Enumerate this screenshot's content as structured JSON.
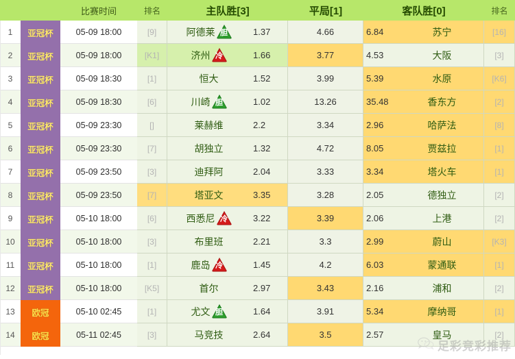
{
  "header": {
    "no": "",
    "league": "",
    "time": "比赛时间",
    "rank_home": "排名",
    "home_win": "主队胜[3]",
    "draw": "平局[1]",
    "away_win": "客队胜[0]",
    "rank_away": "排名"
  },
  "watermark": {
    "text": "足彩竞彩推荐",
    "icon": "wechat-icon"
  },
  "colors": {
    "header_bg": "#b7e76a",
    "league_acl": "#9470ab",
    "league_ucl": "#f4650c",
    "highlight_orange": "#ffd972",
    "highlight_green": "#d6f0ac",
    "cell_bg": "#eef4e4",
    "badge_dan": "#2e9e2e",
    "badge_leng": "#d41b1b"
  },
  "rows": [
    {
      "no": "1",
      "league": "亚冠杯",
      "league_type": "acl",
      "time": "05-09 18:00",
      "home_rank": "[9]",
      "home_team": "阿德莱",
      "home_badge": "胆",
      "home_odd": "1.37",
      "draw_odd": "4.66",
      "away_odd": "6.84",
      "away_team": "苏宁",
      "away_badge": "",
      "away_rank": "[16]",
      "alt": false,
      "home_hl": "",
      "draw_hl": "",
      "away_hl": "orange"
    },
    {
      "no": "2",
      "league": "亚冠杯",
      "league_type": "acl",
      "time": "05-09 18:00",
      "home_rank": "[K1]",
      "home_team": "济州",
      "home_badge": "冷",
      "home_odd": "1.66",
      "draw_odd": "3.77",
      "away_odd": "4.53",
      "away_team": "大阪",
      "away_badge": "",
      "away_rank": "[3]",
      "alt": true,
      "home_hl": "green",
      "draw_hl": "orange",
      "away_hl": ""
    },
    {
      "no": "3",
      "league": "亚冠杯",
      "league_type": "acl",
      "time": "05-09 18:30",
      "home_rank": "[1]",
      "home_team": "恒大",
      "home_badge": "",
      "home_odd": "1.52",
      "draw_odd": "3.99",
      "away_odd": "5.39",
      "away_team": "水原",
      "away_badge": "",
      "away_rank": "[K6]",
      "alt": false,
      "home_hl": "",
      "draw_hl": "",
      "away_hl": "orange"
    },
    {
      "no": "4",
      "league": "亚冠杯",
      "league_type": "acl",
      "time": "05-09 18:30",
      "home_rank": "[6]",
      "home_team": "川崎",
      "home_badge": "胆",
      "home_odd": "1.02",
      "draw_odd": "13.26",
      "away_odd": "35.48",
      "away_team": "香东方",
      "away_badge": "",
      "away_rank": "[2]",
      "alt": true,
      "home_hl": "",
      "draw_hl": "",
      "away_hl": "orange"
    },
    {
      "no": "5",
      "league": "亚冠杯",
      "league_type": "acl",
      "time": "05-09 23:30",
      "home_rank": "[]",
      "home_team": "莱赫维",
      "home_badge": "",
      "home_odd": "2.2",
      "draw_odd": "3.34",
      "away_odd": "2.96",
      "away_team": "哈萨法",
      "away_badge": "",
      "away_rank": "[8]",
      "alt": false,
      "home_hl": "",
      "draw_hl": "",
      "away_hl": "orange"
    },
    {
      "no": "6",
      "league": "亚冠杯",
      "league_type": "acl",
      "time": "05-09 23:30",
      "home_rank": "[7]",
      "home_team": "胡独立",
      "home_badge": "",
      "home_odd": "1.32",
      "draw_odd": "4.72",
      "away_odd": "8.05",
      "away_team": "贾兹拉",
      "away_badge": "",
      "away_rank": "[1]",
      "alt": true,
      "home_hl": "",
      "draw_hl": "",
      "away_hl": "orange"
    },
    {
      "no": "7",
      "league": "亚冠杯",
      "league_type": "acl",
      "time": "05-09 23:50",
      "home_rank": "[3]",
      "home_team": "迪拜阿",
      "home_badge": "",
      "home_odd": "2.04",
      "draw_odd": "3.33",
      "away_odd": "3.34",
      "away_team": "塔火车",
      "away_badge": "",
      "away_rank": "[1]",
      "alt": false,
      "home_hl": "",
      "draw_hl": "",
      "away_hl": "orange"
    },
    {
      "no": "8",
      "league": "亚冠杯",
      "league_type": "acl",
      "time": "05-09 23:50",
      "home_rank": "[7]",
      "home_team": "塔亚文",
      "home_badge": "",
      "home_odd": "3.35",
      "draw_odd": "3.28",
      "away_odd": "2.05",
      "away_team": "德独立",
      "away_badge": "",
      "away_rank": "[2]",
      "alt": true,
      "home_hl": "orange",
      "draw_hl": "",
      "away_hl": ""
    },
    {
      "no": "9",
      "league": "亚冠杯",
      "league_type": "acl",
      "time": "05-10 18:00",
      "home_rank": "[6]",
      "home_team": "西悉尼",
      "home_badge": "冷",
      "home_odd": "3.22",
      "draw_odd": "3.39",
      "away_odd": "2.06",
      "away_team": "上港",
      "away_badge": "",
      "away_rank": "[2]",
      "alt": false,
      "home_hl": "",
      "draw_hl": "orange",
      "away_hl": ""
    },
    {
      "no": "10",
      "league": "亚冠杯",
      "league_type": "acl",
      "time": "05-10 18:00",
      "home_rank": "[3]",
      "home_team": "布里班",
      "home_badge": "",
      "home_odd": "2.21",
      "draw_odd": "3.3",
      "away_odd": "2.99",
      "away_team": "蔚山",
      "away_badge": "",
      "away_rank": "[K3]",
      "alt": true,
      "home_hl": "",
      "draw_hl": "",
      "away_hl": "orange"
    },
    {
      "no": "11",
      "league": "亚冠杯",
      "league_type": "acl",
      "time": "05-10 18:00",
      "home_rank": "[1]",
      "home_team": "鹿岛",
      "home_badge": "冷",
      "home_odd": "1.45",
      "draw_odd": "4.2",
      "away_odd": "6.03",
      "away_team": "蒙通联",
      "away_badge": "",
      "away_rank": "[1]",
      "alt": false,
      "home_hl": "",
      "draw_hl": "",
      "away_hl": "orange"
    },
    {
      "no": "12",
      "league": "亚冠杯",
      "league_type": "acl",
      "time": "05-10 18:00",
      "home_rank": "[K5]",
      "home_team": "首尔",
      "home_badge": "",
      "home_odd": "2.97",
      "draw_odd": "3.43",
      "away_odd": "2.16",
      "away_team": "浦和",
      "away_badge": "",
      "away_rank": "[2]",
      "alt": true,
      "home_hl": "",
      "draw_hl": "orange",
      "away_hl": ""
    },
    {
      "no": "13",
      "league": "欧冠",
      "league_type": "ucl",
      "time": "05-10 02:45",
      "home_rank": "[1]",
      "home_team": "尤文",
      "home_badge": "胆",
      "home_odd": "1.64",
      "draw_odd": "3.91",
      "away_odd": "5.34",
      "away_team": "摩纳哥",
      "away_badge": "",
      "away_rank": "[1]",
      "alt": false,
      "home_hl": "",
      "draw_hl": "",
      "away_hl": "orange"
    },
    {
      "no": "14",
      "league": "欧冠",
      "league_type": "ucl",
      "time": "05-11 02:45",
      "home_rank": "[3]",
      "home_team": "马竞技",
      "home_badge": "",
      "home_odd": "2.64",
      "draw_odd": "3.5",
      "away_odd": "2.57",
      "away_team": "皇马",
      "away_badge": "",
      "away_rank": "[2]",
      "alt": true,
      "home_hl": "",
      "draw_hl": "orange",
      "away_hl": ""
    }
  ]
}
